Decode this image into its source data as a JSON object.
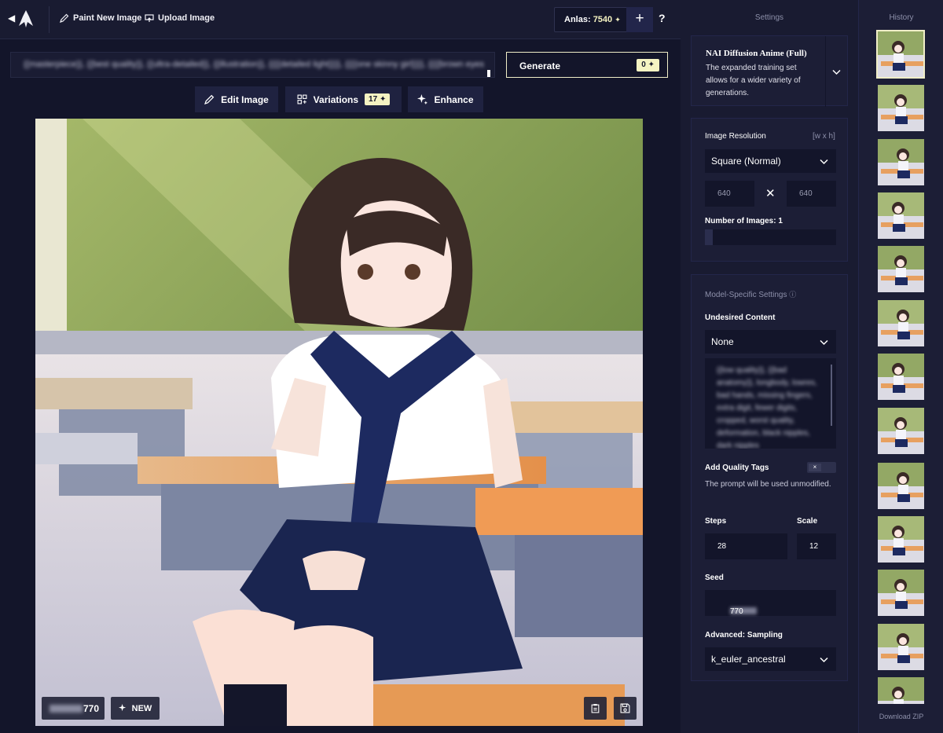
{
  "toolbar": {
    "paint_label": "Paint New Image",
    "upload_label": "Upload Image",
    "anlas_label": "Anlas:",
    "anlas_value": "7540",
    "plus": "+",
    "help": "?"
  },
  "prompt": {
    "text": "{{masterpiece}}, {{best quality}}, {{ultra-detailed}}, {{illustration}}, {{{{detailed light}}}}, {{{{one skinny girl}}}}, {{{{brown eyes}}}}, bob black"
  },
  "generate": {
    "label": "Generate",
    "cost": "0"
  },
  "actions": {
    "edit_label": "Edit Image",
    "variations_label": "Variations",
    "variations_cost": "17",
    "enhance_label": "Enhance"
  },
  "image": {
    "seed_suffix": "770",
    "new_label": "NEW"
  },
  "settings": {
    "title": "Settings",
    "model": {
      "name": "NAI Diffusion Anime (Full)",
      "description": "The expanded training set allows for a wider variety of generations."
    },
    "resolution": {
      "label": "Image Resolution",
      "hint": "[w x h]",
      "preset": "Square (Normal)",
      "width": "640",
      "height": "640"
    },
    "num_images": {
      "label": "Number of Images:",
      "value": "1"
    },
    "model_specific": {
      "label": "Model-Specific Settings"
    },
    "undesired": {
      "label": "Undesired Content",
      "preset": "None",
      "text": "{{low quality}}, {{bad anatomy}}, longbody, lowres, bad hands, missing fingers, extra digit, fewer digits, cropped, worst quality, deformation, black nipples, dark nipples"
    },
    "quality_tags": {
      "label": "Add Quality Tags",
      "toggle_symbol": "×",
      "note": "The prompt will be used unmodified."
    },
    "steps": {
      "label": "Steps",
      "value": "28"
    },
    "scale": {
      "label": "Scale",
      "value": "12"
    },
    "seed": {
      "label": "Seed",
      "suffix": "770"
    },
    "sampling": {
      "label": "Advanced: Sampling",
      "value": "k_euler_ancestral"
    }
  },
  "history": {
    "title": "History",
    "download_label": "Download ZIP"
  },
  "colors": {
    "background": "#13152a",
    "panel": "#191b31",
    "accent": "#f5f3c2"
  }
}
